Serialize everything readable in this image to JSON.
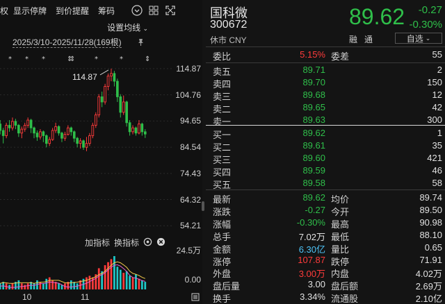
{
  "toolbar": {
    "truncated": "权",
    "items": [
      "显示停牌",
      "到价提醒",
      "筹码"
    ]
  },
  "chart": {
    "avg_setting": "设置均线",
    "range_label": "2025/3/10-2025/11/28(169根)",
    "high_label": "114.87",
    "y_ticks": [
      "114.87",
      "104.76",
      "94.65",
      "84.54",
      "74.43",
      "64.32",
      "54.21"
    ],
    "vol_ticks": [
      "24.5万",
      "0.00"
    ],
    "x_ticks": [
      "10",
      "11"
    ],
    "indicators": [
      "加指标",
      "换指标"
    ]
  },
  "chart_data": {
    "type": "candlestick",
    "ylim": [
      54.21,
      114.87
    ],
    "y_ticks": [
      114.87,
      104.76,
      94.65,
      84.54,
      74.43,
      64.32,
      54.21
    ],
    "x_ticks": [
      "10",
      "11"
    ],
    "high_annotation": 114.87,
    "candles": [
      {
        "o": 93.5,
        "c": 91.0,
        "h": 95.0,
        "l": 89.5
      },
      {
        "o": 91.0,
        "c": 89.0,
        "h": 92.0,
        "l": 86.0
      },
      {
        "o": 89.0,
        "c": 93.0,
        "h": 94.0,
        "l": 88.0
      },
      {
        "o": 93.0,
        "c": 92.0,
        "h": 95.0,
        "l": 90.5
      },
      {
        "o": 92.0,
        "c": 94.5,
        "h": 96.0,
        "l": 91.0
      },
      {
        "o": 94.5,
        "c": 93.0,
        "h": 95.5,
        "l": 91.5
      },
      {
        "o": 93.0,
        "c": 90.0,
        "h": 93.5,
        "l": 88.5
      },
      {
        "o": 90.0,
        "c": 91.5,
        "h": 92.5,
        "l": 88.0
      },
      {
        "o": 91.5,
        "c": 93.0,
        "h": 94.0,
        "l": 90.5
      },
      {
        "o": 93.0,
        "c": 95.0,
        "h": 96.0,
        "l": 92.0
      },
      {
        "o": 95.0,
        "c": 92.0,
        "h": 95.5,
        "l": 90.0
      },
      {
        "o": 92.0,
        "c": 90.0,
        "h": 92.5,
        "l": 88.0
      },
      {
        "o": 90.0,
        "c": 88.5,
        "h": 91.0,
        "l": 87.0
      },
      {
        "o": 88.5,
        "c": 90.5,
        "h": 91.5,
        "l": 87.5
      },
      {
        "o": 90.5,
        "c": 89.0,
        "h": 91.0,
        "l": 86.5
      },
      {
        "o": 89.0,
        "c": 86.0,
        "h": 89.5,
        "l": 84.5
      },
      {
        "o": 86.0,
        "c": 87.5,
        "h": 88.5,
        "l": 85.0
      },
      {
        "o": 87.5,
        "c": 91.0,
        "h": 92.0,
        "l": 87.0
      },
      {
        "o": 91.0,
        "c": 92.5,
        "h": 94.0,
        "l": 90.0
      },
      {
        "o": 92.5,
        "c": 90.0,
        "h": 93.0,
        "l": 89.0
      },
      {
        "o": 90.0,
        "c": 88.0,
        "h": 90.5,
        "l": 86.5
      },
      {
        "o": 88.0,
        "c": 89.5,
        "h": 90.5,
        "l": 87.0
      },
      {
        "o": 89.5,
        "c": 92.0,
        "h": 93.0,
        "l": 89.0
      },
      {
        "o": 92.0,
        "c": 90.5,
        "h": 92.5,
        "l": 89.0
      },
      {
        "o": 90.5,
        "c": 88.0,
        "h": 91.0,
        "l": 86.5
      },
      {
        "o": 88.0,
        "c": 86.0,
        "h": 88.5,
        "l": 84.5
      },
      {
        "o": 86.0,
        "c": 87.0,
        "h": 88.0,
        "l": 84.0
      },
      {
        "o": 87.0,
        "c": 84.5,
        "h": 87.5,
        "l": 83.5
      },
      {
        "o": 84.5,
        "c": 86.0,
        "h": 88.5,
        "l": 83.0
      },
      {
        "o": 86.0,
        "c": 89.0,
        "h": 90.0,
        "l": 85.0
      },
      {
        "o": 89.0,
        "c": 93.0,
        "h": 94.0,
        "l": 88.0
      },
      {
        "o": 93.0,
        "c": 97.0,
        "h": 98.0,
        "l": 92.0
      },
      {
        "o": 97.0,
        "c": 104.0,
        "h": 105.0,
        "l": 96.0
      },
      {
        "o": 104.0,
        "c": 102.0,
        "h": 106.0,
        "l": 100.0
      },
      {
        "o": 102.0,
        "c": 108.0,
        "h": 109.0,
        "l": 101.0
      },
      {
        "o": 108.0,
        "c": 112.0,
        "h": 113.0,
        "l": 106.5
      },
      {
        "o": 112.0,
        "c": 113.0,
        "h": 114.87,
        "l": 110.0
      },
      {
        "o": 113.0,
        "c": 110.0,
        "h": 114.0,
        "l": 108.0
      },
      {
        "o": 110.0,
        "c": 104.0,
        "h": 111.0,
        "l": 102.0
      },
      {
        "o": 104.0,
        "c": 98.0,
        "h": 105.0,
        "l": 96.0
      },
      {
        "o": 98.0,
        "c": 102.0,
        "h": 104.5,
        "l": 97.0
      },
      {
        "o": 102.0,
        "c": 94.0,
        "h": 102.5,
        "l": 92.5
      },
      {
        "o": 94.0,
        "c": 90.5,
        "h": 95.0,
        "l": 89.0
      },
      {
        "o": 90.5,
        "c": 92.0,
        "h": 93.0,
        "l": 89.5
      },
      {
        "o": 92.0,
        "c": 90.0,
        "h": 92.5,
        "l": 89.0
      },
      {
        "o": 90.0,
        "c": 93.5,
        "h": 95.0,
        "l": 89.5
      },
      {
        "o": 93.5,
        "c": 90.5,
        "h": 94.0,
        "l": 89.0
      },
      {
        "o": 90.5,
        "c": 89.62,
        "h": 91.5,
        "l": 88.1
      }
    ],
    "volume": [
      4,
      5,
      4,
      3,
      4,
      5,
      6,
      4,
      3,
      4,
      5,
      4,
      6,
      5,
      4,
      7,
      8,
      6,
      5,
      4,
      3,
      4,
      5,
      6,
      5,
      4,
      6,
      7,
      8,
      9,
      8,
      10,
      14,
      12,
      16,
      18,
      20,
      22,
      15,
      13,
      11,
      12,
      9,
      8,
      10,
      7,
      6,
      5
    ]
  },
  "quote": {
    "name": "国科微",
    "code": "300672",
    "market": "休市 CNY",
    "price": "89.62",
    "change": "-0.27",
    "pct": "-0.30%",
    "tags": [
      "融",
      "通"
    ],
    "watch": "自选"
  },
  "orderbook": {
    "ratio_label": "委比",
    "ratio": "5.15%",
    "diff_label": "委差",
    "diff": "55",
    "asks": [
      {
        "label": "卖五",
        "price": "89.71",
        "vol": "2"
      },
      {
        "label": "卖四",
        "price": "89.70",
        "vol": "150"
      },
      {
        "label": "卖三",
        "price": "89.68",
        "vol": "12"
      },
      {
        "label": "卖二",
        "price": "89.65",
        "vol": "42"
      },
      {
        "label": "卖一",
        "price": "89.63",
        "vol": "300"
      }
    ],
    "bids": [
      {
        "label": "买一",
        "price": "89.62",
        "vol": "1"
      },
      {
        "label": "买二",
        "price": "89.61",
        "vol": "35"
      },
      {
        "label": "买三",
        "price": "89.60",
        "vol": "421"
      },
      {
        "label": "买四",
        "price": "89.59",
        "vol": "46"
      },
      {
        "label": "买五",
        "price": "89.58",
        "vol": "58"
      }
    ]
  },
  "stats": [
    {
      "l1": "最新",
      "v1": "89.62",
      "c1": "g",
      "l2": "均价",
      "v2": "89.74",
      "c2": "g"
    },
    {
      "l1": "涨跌",
      "v1": "-0.27",
      "c1": "g",
      "l2": "今开",
      "v2": "89.50",
      "c2": "g"
    },
    {
      "l1": "涨幅",
      "v1": "-0.30%",
      "c1": "g",
      "l2": "最高",
      "v2": "90.98",
      "c2": "r"
    },
    {
      "l1": "总手",
      "v1": "7.02万",
      "c1": "w",
      "l2": "最低",
      "v2": "88.10",
      "c2": "g"
    },
    {
      "l1": "金额",
      "v1": "6.30亿",
      "c1": "b",
      "l2": "量比",
      "v2": "0.65",
      "c2": "w"
    },
    {
      "l1": "涨停",
      "v1": "107.87",
      "c1": "r",
      "l2": "跌停",
      "v2": "71.91",
      "c2": "g"
    },
    {
      "l1": "外盘",
      "v1": "3.00万",
      "c1": "r",
      "l2": "内盘",
      "v2": "4.02万",
      "c2": "g"
    },
    {
      "l1": "盘后量",
      "v1": "3.00",
      "c1": "w",
      "l2": "盘后额",
      "v2": "2.69万",
      "c2": "b"
    },
    {
      "l1": "换手",
      "v1": "3.34%",
      "c1": "w",
      "l2": "流通股",
      "v2": "2.10亿",
      "c2": "w"
    }
  ],
  "colors": {
    "up": "#ff3b3b",
    "down": "#2fbf4a",
    "cyan": "#4ec3f7",
    "bg": "#141414"
  }
}
